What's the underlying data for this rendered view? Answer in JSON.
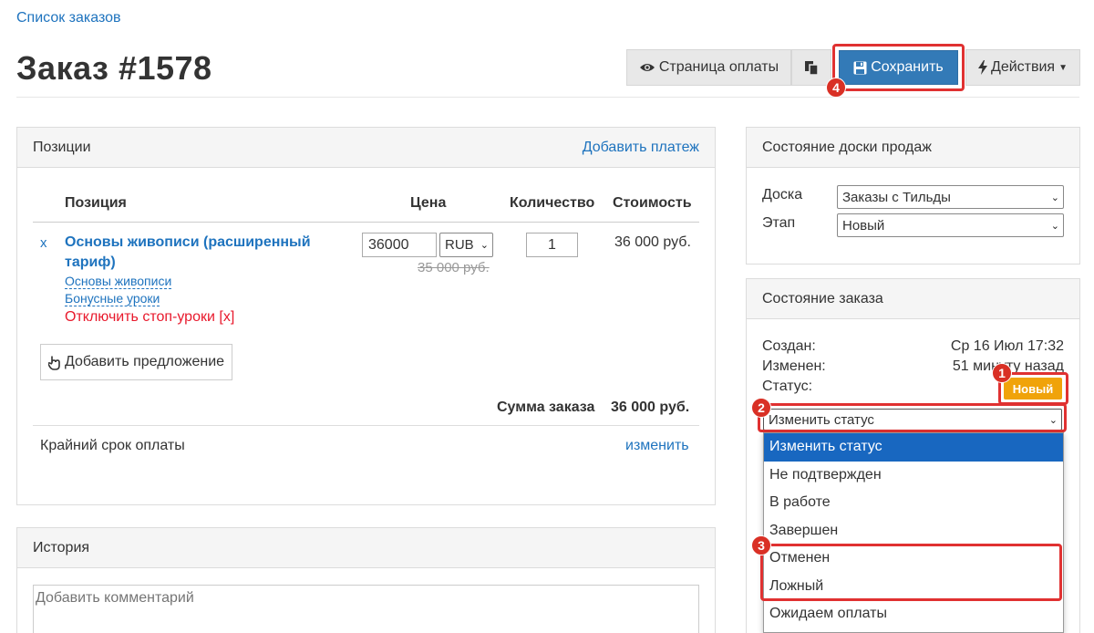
{
  "breadcrumb": "Список заказов",
  "title": "Заказ #1578",
  "toolbar": {
    "payment_page": "Страница оплаты",
    "save": "Сохранить",
    "actions": "Действия"
  },
  "markers": {
    "m1": "1",
    "m2": "2",
    "m3": "3",
    "m4": "4"
  },
  "positions": {
    "header": "Позиции",
    "add_payment": "Добавить платеж",
    "columns": [
      "Позиция",
      "Цена",
      "Количество",
      "Стоимость"
    ],
    "item": {
      "remove": "x",
      "name": "Основы живописи (расширенный тариф)",
      "link1": "Основы живописи",
      "link2": "Бонусные уроки",
      "stop_lessons": "Отключить стоп-уроки",
      "stop_x": "[x]",
      "price": "36000",
      "currency": "RUB",
      "old_price": "35 000 руб.",
      "qty": "1",
      "cost": "36 000 руб."
    },
    "add_offer": "Добавить предложение",
    "sum_label": "Сумма заказа",
    "sum_value": "36 000 руб.",
    "deadline_label": "Крайний срок оплаты",
    "deadline_change": "изменить"
  },
  "history": {
    "header": "История",
    "comment_placeholder": "Добавить комментарий"
  },
  "board": {
    "header": "Состояние доски продаж",
    "board_label": "Доска",
    "board_value": "Заказы с Тильды",
    "stage_label": "Этап",
    "stage_value": "Новый"
  },
  "order_state": {
    "header": "Состояние заказа",
    "created_label": "Создан:",
    "created_value": "Ср 16 Июл 17:32",
    "changed_label": "Изменен:",
    "changed_value": "51 минуту назад",
    "status_label": "Статус:",
    "status_badge": "Новый",
    "change_status": "Изменить статус",
    "options": [
      "Изменить статус",
      "Не подтвержден",
      "В работе",
      "Завершен",
      "Отменен",
      "Ложный",
      "Ожидаем оплаты"
    ]
  },
  "colors": {
    "accent": "#1e73be",
    "save": "#337ab7",
    "badge": "#f0a30a",
    "highlight": "#e03131",
    "selected": "#1867c0"
  }
}
